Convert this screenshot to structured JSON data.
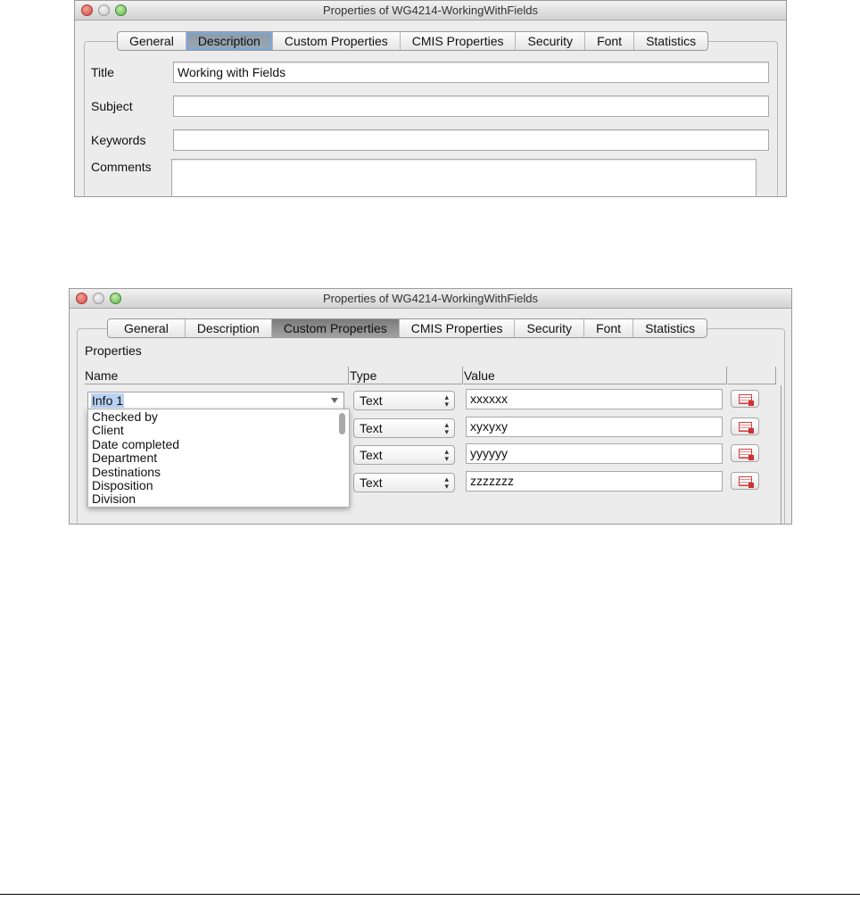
{
  "window1": {
    "title": "Properties of WG4214-WorkingWithFields",
    "tabs": [
      "General",
      "Description",
      "Custom Properties",
      "CMIS Properties",
      "Security",
      "Font",
      "Statistics"
    ],
    "active_tab": "Description",
    "fields": {
      "title_label": "Title",
      "title_value": "Working with Fields",
      "subject_label": "Subject",
      "subject_value": "",
      "keywords_label": "Keywords",
      "keywords_value": "",
      "comments_label": "Comments",
      "comments_value": ""
    }
  },
  "window2": {
    "title": "Properties of WG4214-WorkingWithFields",
    "tabs": [
      "General",
      "Description",
      "Custom Properties",
      "CMIS Properties",
      "Security",
      "Font",
      "Statistics"
    ],
    "active_tab": "Custom Properties",
    "section_label": "Properties",
    "columns": {
      "name": "Name",
      "type": "Type",
      "value": "Value"
    },
    "name_combo_value": "Info 1",
    "dropdown_options": [
      "Checked by",
      "Client",
      "Date completed",
      "Department",
      "Destinations",
      "Disposition",
      "Division"
    ],
    "rows": [
      {
        "type": "Text",
        "value": "xxxxxx"
      },
      {
        "type": "Text",
        "value": "xyxyxy"
      },
      {
        "type": "Text",
        "value": "yyyyyy"
      },
      {
        "type": "Text",
        "value": "zzzzzzz"
      }
    ]
  }
}
